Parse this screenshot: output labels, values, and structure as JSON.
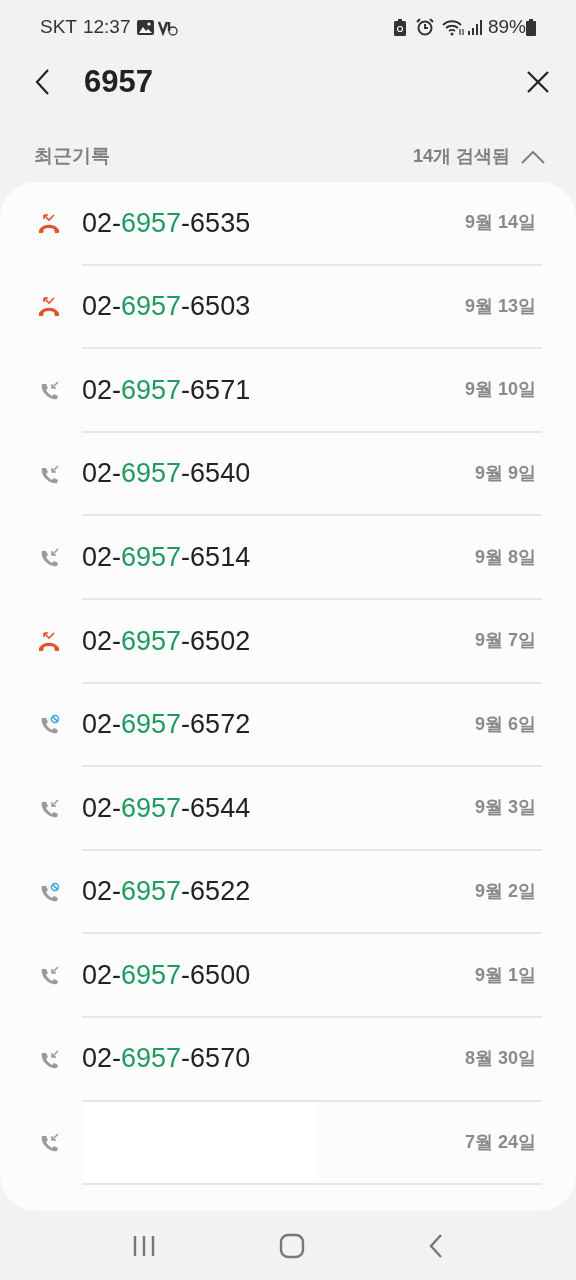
{
  "status_bar": {
    "carrier": "SKT",
    "time": "12:37",
    "battery": "89%"
  },
  "search": {
    "value": "6957"
  },
  "section": {
    "title": "최근기록",
    "count": "14개 검색됨",
    "expanded": true
  },
  "calls": [
    {
      "kind": "missed",
      "prefix": "02-",
      "match": "6957",
      "suffix": "-6535",
      "date": "9월 14일"
    },
    {
      "kind": "missed",
      "prefix": "02-",
      "match": "6957",
      "suffix": "-6503",
      "date": "9월 13일"
    },
    {
      "kind": "incoming",
      "prefix": "02-",
      "match": "6957",
      "suffix": "-6571",
      "date": "9월 10일"
    },
    {
      "kind": "incoming",
      "prefix": "02-",
      "match": "6957",
      "suffix": "-6540",
      "date": "9월 9일"
    },
    {
      "kind": "incoming",
      "prefix": "02-",
      "match": "6957",
      "suffix": "-6514",
      "date": "9월 8일"
    },
    {
      "kind": "missed",
      "prefix": "02-",
      "match": "6957",
      "suffix": "-6502",
      "date": "9월 7일"
    },
    {
      "kind": "blocked",
      "prefix": "02-",
      "match": "6957",
      "suffix": "-6572",
      "date": "9월 6일"
    },
    {
      "kind": "incoming",
      "prefix": "02-",
      "match": "6957",
      "suffix": "-6544",
      "date": "9월 3일"
    },
    {
      "kind": "blocked",
      "prefix": "02-",
      "match": "6957",
      "suffix": "-6522",
      "date": "9월 2일"
    },
    {
      "kind": "incoming",
      "prefix": "02-",
      "match": "6957",
      "suffix": "-6500",
      "date": "9월 1일"
    },
    {
      "kind": "incoming",
      "prefix": "02-",
      "match": "6957",
      "suffix": "-6570",
      "date": "8월 30일"
    },
    {
      "kind": "incoming",
      "redacted": true,
      "date": "7월 24일"
    }
  ]
}
